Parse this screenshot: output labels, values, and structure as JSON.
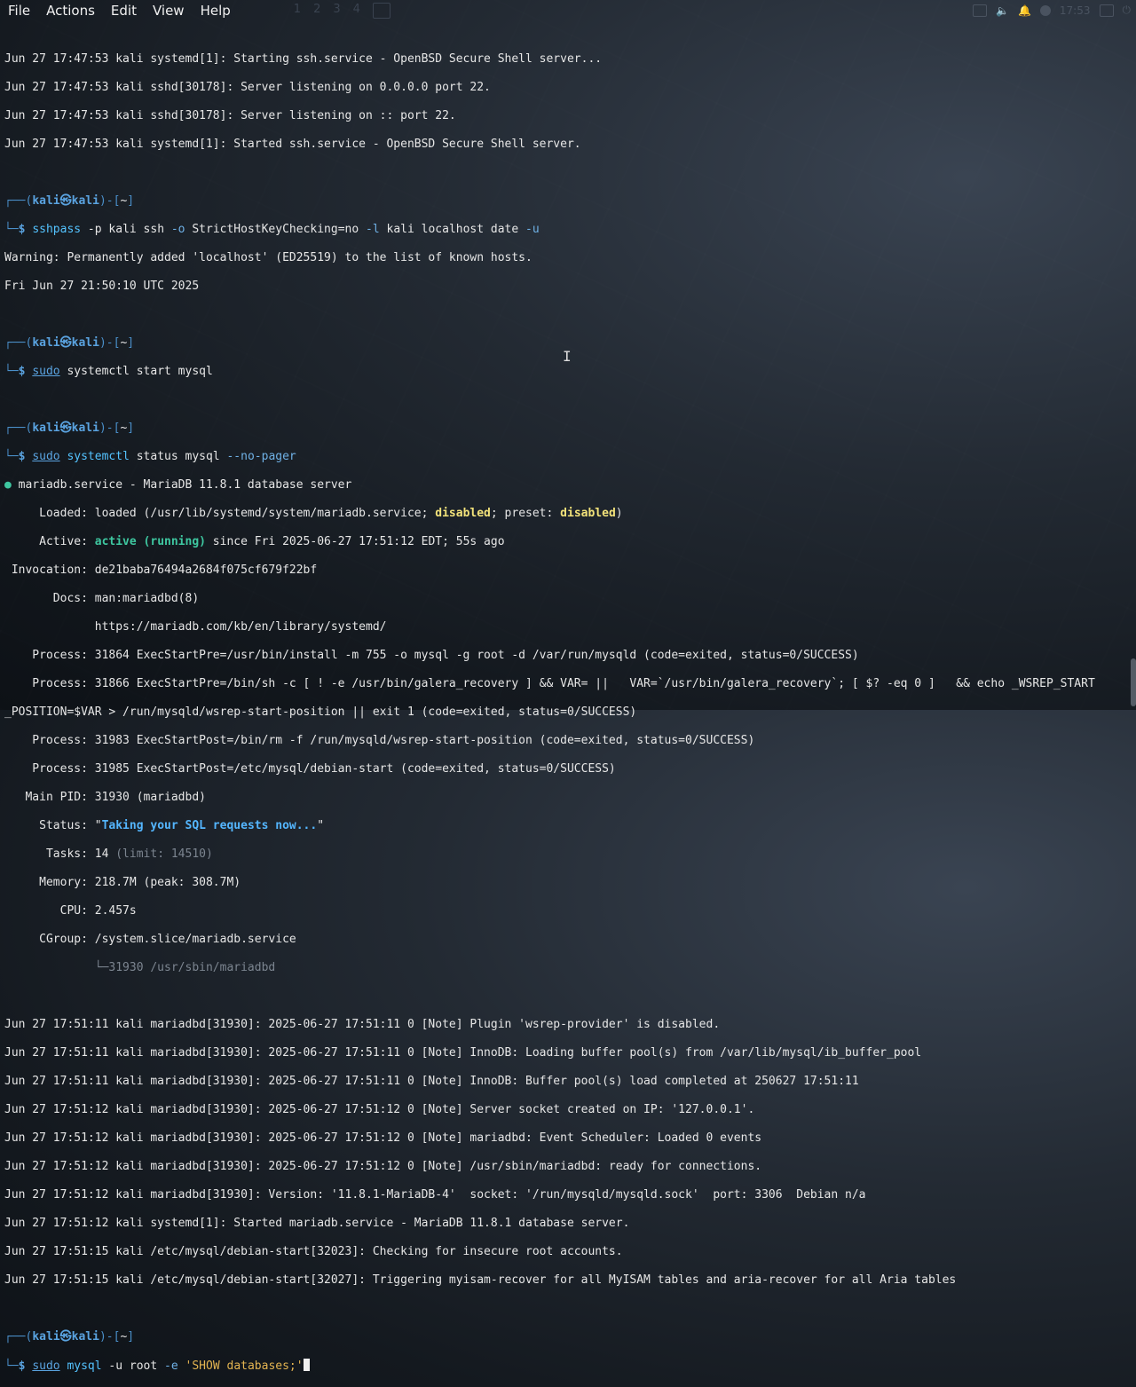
{
  "menubar": {
    "file": "File",
    "actions": "Actions",
    "edit": "Edit",
    "view": "View",
    "help": "Help"
  },
  "workspaces": [
    "1",
    "2",
    "3",
    "4"
  ],
  "tray": {
    "clock": "17:53"
  },
  "terminal": {
    "lines": [
      "Jun 27 17:47:53 kali systemd[1]: Starting ssh.service - OpenBSD Secure Shell server...",
      "Jun 27 17:47:53 kali sshd[30178]: Server listening on 0.0.0.0 port 22.",
      "Jun 27 17:47:53 kali sshd[30178]: Server listening on :: port 22.",
      "Jun 27 17:47:53 kali systemd[1]: Started ssh.service - OpenBSD Secure Shell server."
    ],
    "prompt_user": "kali",
    "prompt_host": "kali",
    "prompt_dir": "~",
    "cmd1": {
      "bin": "sshpass",
      "args1": " -p kali ssh ",
      "opt1": "-o",
      "args2": " StrictHostKeyChecking=no ",
      "opt2": "-l",
      "args3": " kali localhost date ",
      "opt3": "-u"
    },
    "out1": [
      "Warning: Permanently added 'localhost' (ED25519) to the list of known hosts.",
      "Fri Jun 27 21:50:10 UTC 2025"
    ],
    "cmd2": {
      "sudo": "sudo",
      "rest": " systemctl start mysql",
      "bin": "systemctl"
    },
    "cmd3": {
      "sudo": "sudo",
      "bin": "systemctl",
      "rest": " status mysql ",
      "opt": "--no-pager"
    },
    "status": {
      "header": " mariadb.service - MariaDB 11.8.1 database server",
      "loaded_label": "     Loaded: ",
      "loaded_a": "loaded (/usr/lib/systemd/system/mariadb.service; ",
      "loaded_dis1": "disabled",
      "loaded_b": "; preset: ",
      "loaded_dis2": "disabled",
      "loaded_c": ")",
      "active_label": "     Active: ",
      "active_val": "active (running)",
      "active_rest": " since Fri 2025-06-27 17:51:12 EDT; 55s ago",
      "invocation": " Invocation: de21baba76494a2684f075cf679f22bf",
      "docs": "       Docs: man:mariadbd(8)",
      "docs_url": "             https://mariadb.com/kb/en/library/systemd/",
      "proc1": "    Process: 31864 ExecStartPre=/usr/bin/install -m 755 -o mysql -g root -d /var/run/mysqld (code=exited, status=0/SUCCESS)",
      "proc2": "    Process: 31866 ExecStartPre=/bin/sh -c [ ! -e /usr/bin/galera_recovery ] && VAR= ||   VAR=`/usr/bin/galera_recovery`; [ $? -eq 0 ]   && echo _WSREP_START",
      "proc2b": "_POSITION=$VAR > /run/mysqld/wsrep-start-position || exit 1 (code=exited, status=0/SUCCESS)",
      "proc3": "    Process: 31983 ExecStartPost=/bin/rm -f /run/mysqld/wsrep-start-position (code=exited, status=0/SUCCESS)",
      "proc4": "    Process: 31985 ExecStartPost=/etc/mysql/debian-start (code=exited, status=0/SUCCESS)",
      "mainpid": "   Main PID: 31930 (mariadbd)",
      "status_label": "     Status: \"",
      "status_val": "Taking your SQL requests now...",
      "status_end": "\"",
      "tasks_a": "      Tasks: 14 ",
      "tasks_b": "(limit: 14510)",
      "memory": "     Memory: 218.7M (peak: 308.7M)",
      "cpu": "        CPU: 2.457s",
      "cgroup": "     CGroup: /system.slice/mariadb.service",
      "cgroup_child": "             └─31930 /usr/sbin/mariadbd"
    },
    "logs": [
      "Jun 27 17:51:11 kali mariadbd[31930]: 2025-06-27 17:51:11 0 [Note] Plugin 'wsrep-provider' is disabled.",
      "Jun 27 17:51:11 kali mariadbd[31930]: 2025-06-27 17:51:11 0 [Note] InnoDB: Loading buffer pool(s) from /var/lib/mysql/ib_buffer_pool",
      "Jun 27 17:51:11 kali mariadbd[31930]: 2025-06-27 17:51:11 0 [Note] InnoDB: Buffer pool(s) load completed at 250627 17:51:11",
      "Jun 27 17:51:12 kali mariadbd[31930]: 2025-06-27 17:51:12 0 [Note] Server socket created on IP: '127.0.0.1'.",
      "Jun 27 17:51:12 kali mariadbd[31930]: 2025-06-27 17:51:12 0 [Note] mariadbd: Event Scheduler: Loaded 0 events",
      "Jun 27 17:51:12 kali mariadbd[31930]: 2025-06-27 17:51:12 0 [Note] /usr/sbin/mariadbd: ready for connections.",
      "Jun 27 17:51:12 kali mariadbd[31930]: Version: '11.8.1-MariaDB-4'  socket: '/run/mysqld/mysqld.sock'  port: 3306  Debian n/a",
      "Jun 27 17:51:12 kali systemd[1]: Started mariadb.service - MariaDB 11.8.1 database server.",
      "Jun 27 17:51:15 kali /etc/mysql/debian-start[32023]: Checking for insecure root accounts.",
      "Jun 27 17:51:15 kali /etc/mysql/debian-start[32027]: Triggering myisam-recover for all MyISAM tables and aria-recover for all Aria tables"
    ],
    "cmd4": {
      "sudo": "sudo",
      "bin": "mysql",
      "args": " -u root ",
      "opt": "-e",
      "str": "'SHOW databases;'"
    }
  }
}
